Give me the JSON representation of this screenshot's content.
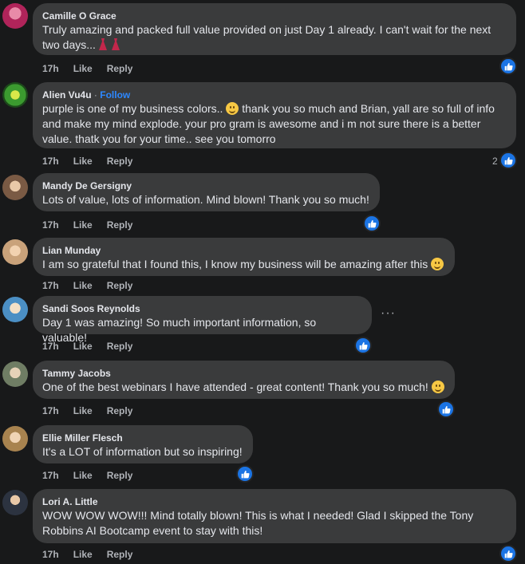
{
  "comments": [
    {
      "author": "Camille O Grace",
      "text": "Truly amazing and packed full value provided on just Day 1 already. I can't wait for the next two days...",
      "time": "17h",
      "like": "Like",
      "reply": "Reply",
      "avatar_color": "#b0245a"
    },
    {
      "author": "Alien Vu4u",
      "follow": "Follow",
      "text_a": "purple is one of my business colors..",
      "text_b": " thank you so much and Brian, yall are so full of info and make my mind explode. your pro gram is awesome and i m not sure there is a better value. thatk you for your time.. see you tomorro",
      "time": "17h",
      "like": "Like",
      "reply": "Reply",
      "reaction_count": "2",
      "avatar_color": "#3b9a2f"
    },
    {
      "author": "Mandy De Gersigny",
      "text": "Lots of value, lots of information. Mind blown! Thank you so much!",
      "time": "17h",
      "like": "Like",
      "reply": "Reply",
      "avatar_color": "#7a5a44"
    },
    {
      "author": "Lian Munday",
      "text": "I am so grateful that I found this, I know my business will be amazing after this",
      "time": "17h",
      "like": "Like",
      "reply": "Reply",
      "avatar_color": "#c9a27a"
    },
    {
      "author": "Sandi Soos Reynolds",
      "text": "Day 1 was amazing! So much important information, so valuable!",
      "time": "17h",
      "like": "Like",
      "reply": "Reply",
      "avatar_color": "#4b8fc4"
    },
    {
      "author": "Tammy Jacobs",
      "text": "One of the best webinars I have attended - great content! Thank you so much!",
      "time": "17h",
      "like": "Like",
      "reply": "Reply",
      "avatar_color": "#6f7d64"
    },
    {
      "author": "Ellie Miller Flesch",
      "text": "It's a LOT of information but so inspiring!",
      "time": "17h",
      "like": "Like",
      "reply": "Reply",
      "avatar_color": "#a8834f"
    },
    {
      "author": "Lori A. Little",
      "text": "WOW WOW WOW!!! Mind totally blown! This is what I needed! Glad I skipped the Tony Robbins AI Bootcamp event to stay with this!",
      "time": "17h",
      "like": "Like",
      "reply": "Reply",
      "avatar_color": "#2c3340"
    }
  ],
  "colors": {
    "background": "#18191a",
    "bubble": "#3a3b3c",
    "accent": "#1b74e4",
    "link": "#2d88ff"
  },
  "icons": {
    "reaction": "thumbs-up-icon",
    "more": "more-options-icon"
  }
}
